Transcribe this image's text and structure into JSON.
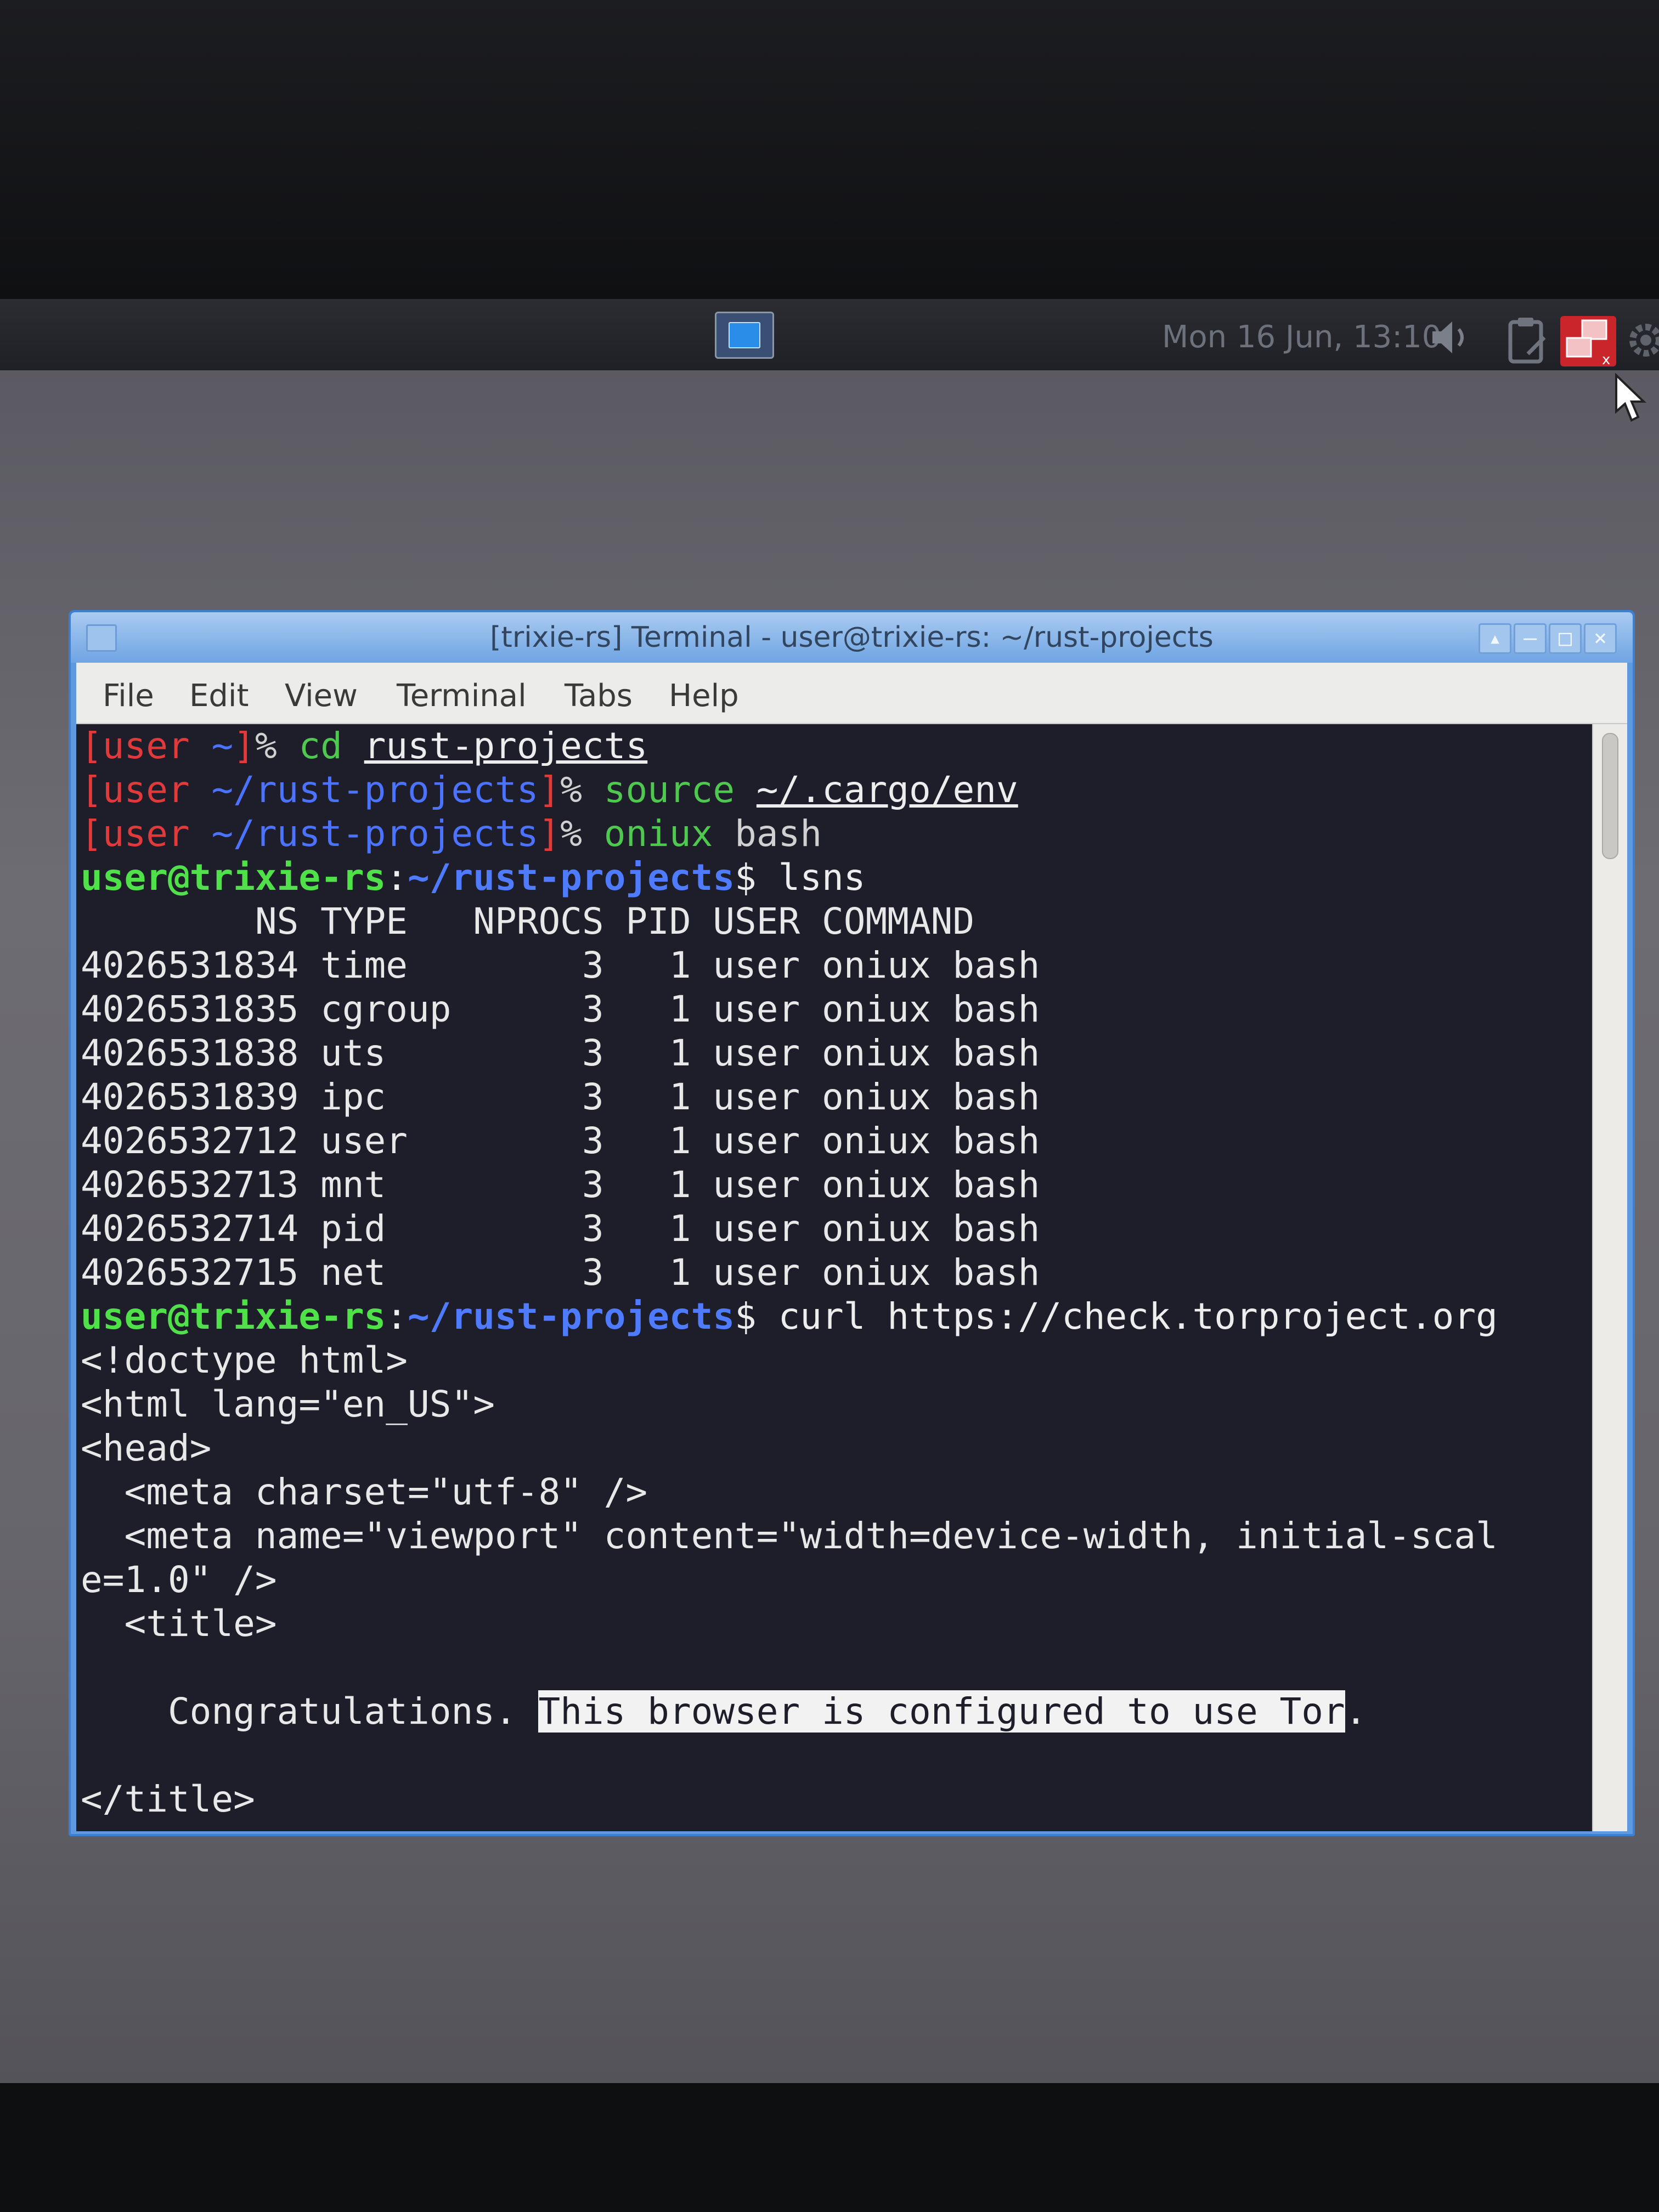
{
  "panel": {
    "clock": "Mon 16 Jun, 13:10"
  },
  "window": {
    "title": "[trixie-rs] Terminal - user@trixie-rs: ~/rust-projects",
    "menu": [
      "File",
      "Edit",
      "View",
      "Terminal",
      "Tabs",
      "Help"
    ]
  },
  "terminal": {
    "zsh_lines": [
      {
        "open": "[",
        "user": "user",
        "dir": " ~",
        "close": "]",
        "pct": "% ",
        "cmd": "cd",
        "sp": " ",
        "arg": "rust-projects"
      },
      {
        "open": "[",
        "user": "user",
        "dir": " ~/rust-projects",
        "close": "]",
        "pct": "% ",
        "cmd": "source",
        "sp": " ",
        "arg": "~/.cargo/env"
      },
      {
        "open": "[",
        "user": "user",
        "dir": " ~/rust-projects",
        "close": "]",
        "pct": "% ",
        "cmd": "oniux",
        "sp": " ",
        "arg": "bash"
      }
    ],
    "bash_prompt": {
      "userhost": "user@trixie-rs",
      "colon": ":",
      "path": "~/rust-projects",
      "dollar": "$ "
    },
    "cmd_lsns": "lsns",
    "lsns_header": "        NS TYPE   NPROCS PID USER COMMAND",
    "lsns_rows": [
      "4026531834 time        3   1 user oniux bash",
      "4026531835 cgroup      3   1 user oniux bash",
      "4026531838 uts         3   1 user oniux bash",
      "4026531839 ipc         3   1 user oniux bash",
      "4026532712 user        3   1 user oniux bash",
      "4026532713 mnt         3   1 user oniux bash",
      "4026532714 pid         3   1 user oniux bash",
      "4026532715 net         3   1 user oniux bash"
    ],
    "cmd_curl": "curl https://check.torproject.org",
    "html_output": [
      "<!doctype html>",
      "<html lang=\"en_US\">",
      "<head>",
      "  <meta charset=\"utf-8\" />",
      "  <meta name=\"viewport\" content=\"width=device-width, initial-scal",
      "e=1.0\" />",
      "  <title>"
    ],
    "congrats_pre": "    Congratulations. ",
    "congrats_sel": "This browser is configured to use Tor",
    "congrats_post": ".",
    "title_close": "</title>"
  }
}
